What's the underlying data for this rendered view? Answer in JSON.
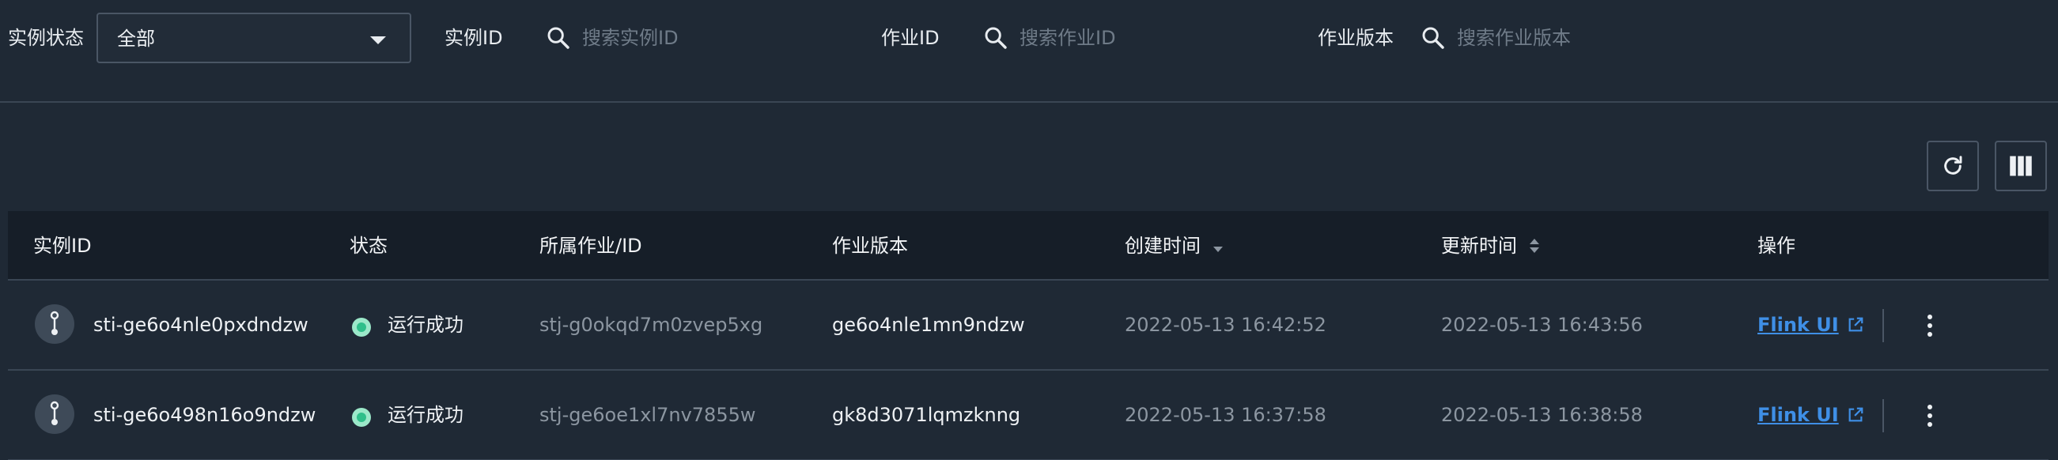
{
  "filters": {
    "status_label": "实例状态",
    "status_value": "全部",
    "instance_id_label": "实例ID",
    "instance_id_placeholder": "搜索实例ID",
    "job_id_label": "作业ID",
    "job_id_placeholder": "搜索作业ID",
    "job_version_label": "作业版本",
    "job_version_placeholder": "搜索作业版本"
  },
  "toolbar": {
    "refresh_icon": "refresh-icon",
    "columns_icon": "columns-icon"
  },
  "table": {
    "headers": {
      "instance_id": "实例ID",
      "status": "状态",
      "job": "所属作业/ID",
      "version": "作业版本",
      "created": "创建时间",
      "updated": "更新时间",
      "actions": "操作"
    },
    "rows": [
      {
        "instance_id": "sti-ge6o4nle0pxdndzw",
        "status": "运行成功",
        "job_id": "stj-g0okqd7m0zvep5xg",
        "version": "ge6o4nle1mn9ndzw",
        "created": "2022-05-13 16:42:52",
        "updated": "2022-05-13 16:43:56",
        "action_link": "Flink UI"
      },
      {
        "instance_id": "sti-ge6o498n16o9ndzw",
        "status": "运行成功",
        "job_id": "stj-ge6oe1xl7nv7855w",
        "version": "gk8d3071lqmzknng",
        "created": "2022-05-13 16:37:58",
        "updated": "2022-05-13 16:38:58",
        "action_link": "Flink UI"
      }
    ]
  },
  "colors": {
    "background": "#1f2935",
    "header_bg": "#161e28",
    "link": "#3f8fe6",
    "success": "#2fbf8a"
  }
}
